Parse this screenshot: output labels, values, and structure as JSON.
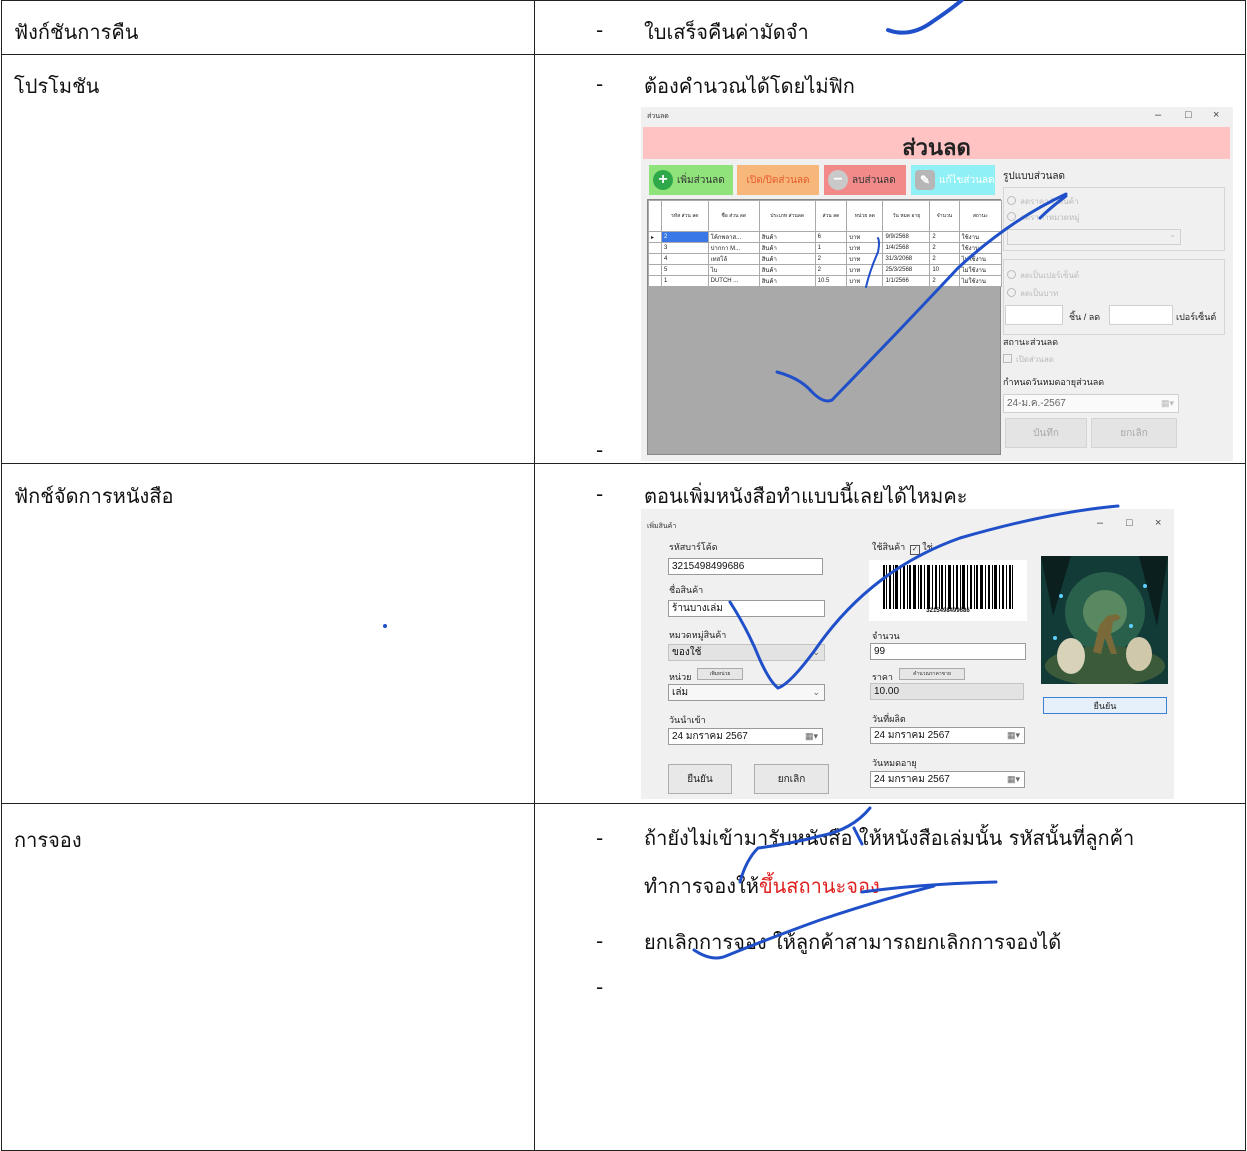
{
  "rows": [
    {
      "label": "ฟังก์ชันการคืน",
      "items": [
        "ใบเสร็จคืนค่ามัดจำ"
      ]
    },
    {
      "label": "โปรโมชัน",
      "items": [
        "ต้องคำนวณได้โดยไม่ฟิก"
      ]
    },
    {
      "label": "ฟักช์จัดการหนังสือ",
      "items": [
        "ตอนเพิ่มหนังสือทำแบบนี้เลยได้ไหมคะ"
      ]
    },
    {
      "label": "การจอง",
      "item1_line1": "ถ้ายังไม่เข้ามารับหนังสือ ให้หนังสือเล่มนั้น รหัสนั้นที่ลูกค้า",
      "item1_line2_start": "ทำการจองให้",
      "item1_line2_red": "ขึ้นสถานะจอง",
      "item2": "ยกเลิกการจอง ให้ลูกค้าสามารถยกเลิกการจองได้"
    }
  ],
  "bullet": "-",
  "discount_window": {
    "title": "ส่วนลด",
    "header": "ส่วนลด",
    "window_controls": {
      "minimize": "–",
      "maximize": "□",
      "close": "×"
    },
    "buttons": {
      "add": "เพิ่มส่วนลด",
      "toggle": "เปิด/ปิดส่วนลด",
      "delete": "ลบส่วนลด",
      "edit": "แก้ไขส่วนลด"
    },
    "columns": [
      "รหัส ส่วน ลด",
      "ชื่อ ส่วน ลด",
      "ประเภท ส่วนลด",
      "ส่วน ลด",
      "หน่วย ลด",
      "วัน หมด อายุ",
      "จำนวน",
      "สถานะ"
    ],
    "rows": [
      [
        "2",
        "โค้กพลาส...",
        "สินค้า",
        "6",
        "บาท",
        "9/9/2568",
        "2",
        "ใช้งาน"
      ],
      [
        "3",
        "ปากกา M...",
        "สินค้า",
        "1",
        "บาท",
        "1/4/2568",
        "2",
        "ใช้งาน"
      ],
      [
        "4",
        "เทสโล้",
        "สินค้า",
        "2",
        "บาท",
        "31/3/2068",
        "2",
        "ไม่ใช้งาน"
      ],
      [
        "5",
        "ไบ",
        "สินค้า",
        "2",
        "บาท",
        "25/3/2568",
        "10",
        "ไม่ใช้งาน"
      ],
      [
        "1",
        "DUTCH ...",
        "สินค้า",
        "10.5",
        "บาท",
        "1/1/2566",
        "2",
        "ไม่ใช้งาน"
      ]
    ],
    "right_panel": {
      "format_title": "รูปแบบส่วนลด",
      "radio_product": "ลดราคาตัวสินค้า",
      "radio_category": "ลดราคาหมวดหมู่",
      "radio_percent": "ลดเป็นเปอร์เซ็นต์",
      "radio_baht": "ลดเป็นบาท",
      "per_unit": "ชิ้น / ลด",
      "percent": "เปอร์เซ็นต์",
      "status_title": "สถานะส่วนลด",
      "status_check": "เปิดส่วนลด",
      "expiry_title": "กำหนดวันหมดอายุส่วนลด",
      "expiry_value": "24-ม.ค.-2567",
      "save": "บันทึก",
      "cancel": "ยกเลิก"
    }
  },
  "product_window": {
    "title": "เพิ่มสินค้า",
    "window_controls": {
      "minimize": "–",
      "maximize": "□",
      "close": "×"
    },
    "barcode_label": "รหัสบาร์โค้ด",
    "barcode_value": "3215498499686",
    "name_label": "ชื่อสินค้า",
    "name_value": "ร้านบางเล่ม",
    "category_label": "หมวดหมู่สินค้า",
    "category_value": "ของใช้",
    "unit_label": "หน่วย",
    "add_unit_button": "เพิ่มหน่วย",
    "unit_value": "เล่ม",
    "import_date_label": "วันนำเข้า",
    "import_date": "24  มกราคม   2567",
    "confirm_button": "ยืนยัน",
    "cancel_button": "ยกเลิก",
    "use_product_label": "ใช้สินค้า",
    "use_product_yes": "ใช่",
    "barcode_number": "3215498499686",
    "qty_label": "จำนวน",
    "qty_value": "99",
    "price_label": "ราคา",
    "calc_price_button": "คำนวณราคาขาย",
    "price_value": "10.00",
    "mfg_date_label": "วันที่ผลิต",
    "mfg_date": "24  มกราคม   2567",
    "exp_date_label": "วันหมดอายุ",
    "exp_date": "24  มกราคม   2567",
    "image_confirm_button": "ยืนยัน"
  },
  "colors": {
    "header_pink": "#ffc3c3",
    "btn_add_green": "#8fe37a",
    "btn_toggle_orange": "#f7b77a",
    "btn_delete_red": "#f28a8a",
    "btn_edit_cyan": "#8ff0f5",
    "annotation_ink": "#1f4fc9",
    "reserve_status_red": "#e02020"
  }
}
